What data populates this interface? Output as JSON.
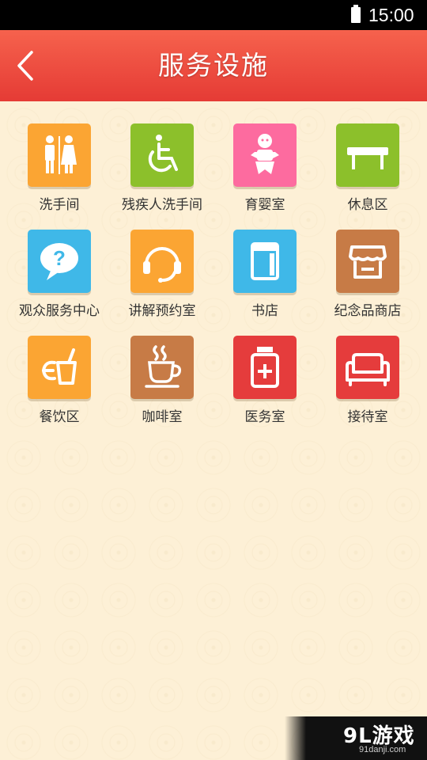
{
  "status_bar": {
    "time": "15:00"
  },
  "header": {
    "title": "服务设施"
  },
  "facilities": [
    {
      "label": "洗手间",
      "icon": "restroom-icon",
      "color": "#fba533"
    },
    {
      "label": "残疾人洗手间",
      "icon": "wheelchair-icon",
      "color": "#8cc02b"
    },
    {
      "label": "育婴室",
      "icon": "baby-icon",
      "color": "#fd6b9f"
    },
    {
      "label": "休息区",
      "icon": "bench-icon",
      "color": "#8cc02b"
    },
    {
      "label": "观众服务中心",
      "icon": "question-bubble-icon",
      "color": "#3fb8e8"
    },
    {
      "label": "讲解预约室",
      "icon": "headphones-icon",
      "color": "#fba533"
    },
    {
      "label": "书店",
      "icon": "book-icon",
      "color": "#3fb8e8"
    },
    {
      "label": "纪念品商店",
      "icon": "shop-icon",
      "color": "#c77b46"
    },
    {
      "label": "餐饮区",
      "icon": "drink-icon",
      "color": "#fba533"
    },
    {
      "label": "咖啡室",
      "icon": "coffee-cup-icon",
      "color": "#c77b46"
    },
    {
      "label": "医务室",
      "icon": "medicine-icon",
      "color": "#e53c3c"
    },
    {
      "label": "接待室",
      "icon": "sofa-icon",
      "color": "#e53c3c"
    }
  ],
  "watermark": {
    "logo": "9L游戏",
    "url": "91danji.com"
  }
}
